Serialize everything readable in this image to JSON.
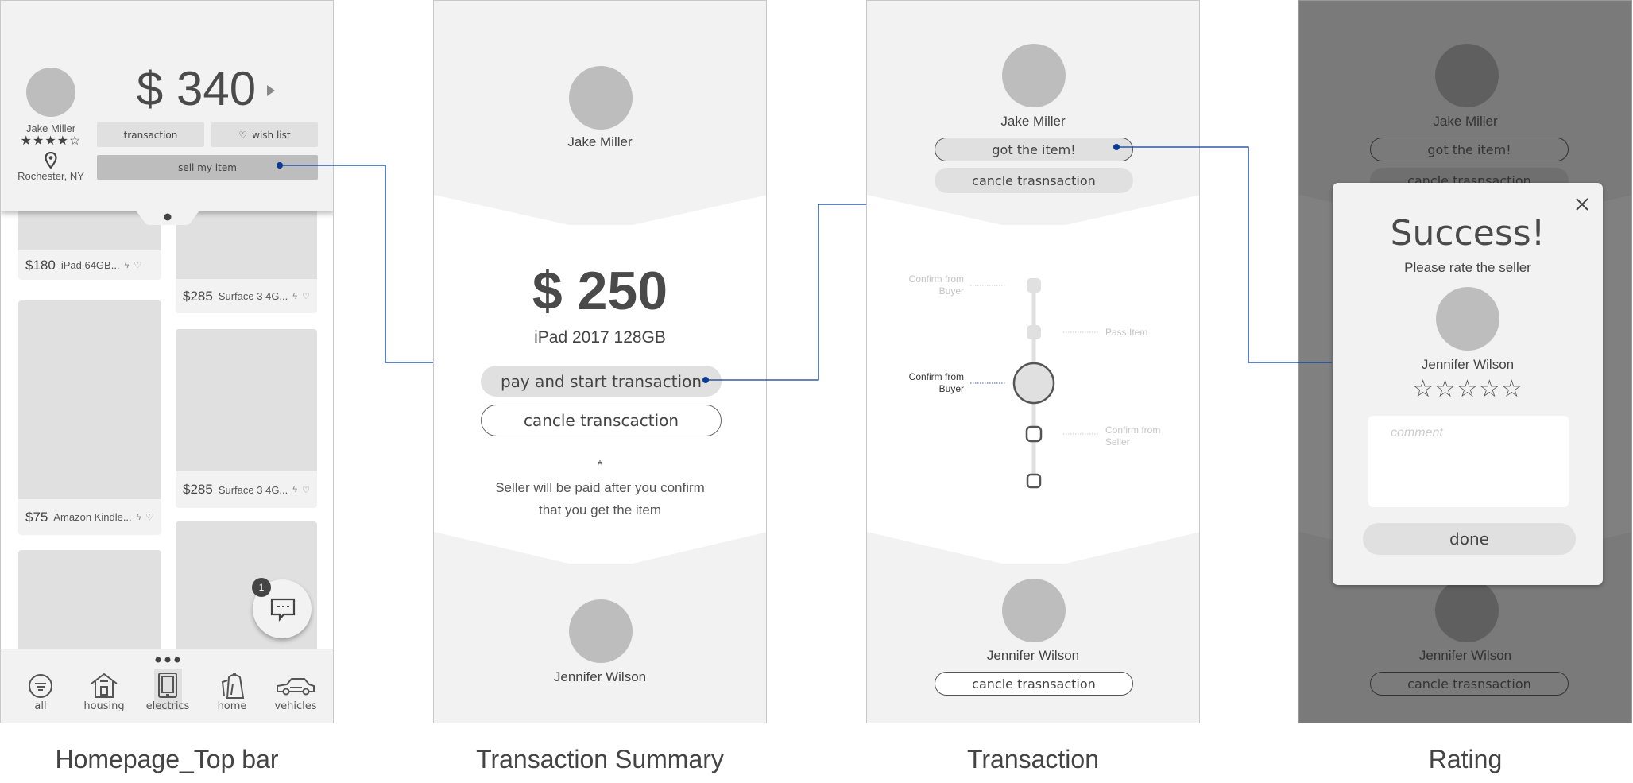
{
  "colors": {
    "connector": "#0b3a94",
    "panel_bg": "#f2f2f2",
    "overlay": "#7b7b7b"
  },
  "homepage": {
    "caption": "Homepage_Top bar",
    "user": {
      "name": "Jake Miller",
      "rating": 4,
      "rating_max": 5,
      "stars": "★★★★☆",
      "location": "Rochester, NY"
    },
    "balance": "$ 340",
    "buttons": {
      "transaction": "transaction",
      "wish_list": "wish list",
      "sell": "sell my item"
    },
    "products": [
      {
        "price": "$180",
        "title": "iPad 64GB..."
      },
      {
        "price": "$285",
        "title": "Surface 3 4G..."
      },
      {
        "price": "$75",
        "title": "Amazon Kindle..."
      },
      {
        "price": "$285",
        "title": "Surface 3 4G..."
      }
    ],
    "chat_badge": "1",
    "nav": [
      {
        "label": "all",
        "icon": "filter-icon"
      },
      {
        "label": "housing",
        "icon": "house-icon"
      },
      {
        "label": "electrics",
        "icon": "tablet-icon",
        "active": true
      },
      {
        "label": "home",
        "icon": "kettle-icon"
      },
      {
        "label": "vehicles",
        "icon": "car-icon"
      }
    ]
  },
  "summary": {
    "caption": "Transaction Summary",
    "seller": "Jake Miller",
    "price": "$ 250",
    "item": "iPad 2017 128GB",
    "pay": "pay and start transaction",
    "cancel": "cancle transcaction",
    "note_mark": "*",
    "note_line1": "Seller will be paid after you confirm",
    "note_line2": "that you get the item",
    "buyer": "Jennifer Wilson"
  },
  "transaction": {
    "caption": "Transaction",
    "seller": "Jake Miller",
    "got_item": "got the item!",
    "cancel_top": "cancle trasnsaction",
    "steps": [
      {
        "label": "Confirm from Buyer",
        "state": "done"
      },
      {
        "label": "Pass Item",
        "state": "done"
      },
      {
        "label": "Confirm from Buyer",
        "state": "current"
      },
      {
        "label": "Confirm from Seller",
        "state": "pending"
      },
      {
        "label": "",
        "state": "pending"
      }
    ],
    "buyer": "Jennifer Wilson",
    "cancel_bottom": "cancle trasnsaction"
  },
  "rating": {
    "caption": "Rating",
    "seller": "Jake Miller",
    "got_item": "got the item!",
    "cancel_top": "cancle trasnsaction",
    "buyer": "Jennifer Wilson",
    "cancel_bottom": "cancle trasnsaction",
    "modal": {
      "title": "Success!",
      "subtitle": "Please rate the seller",
      "name": "Jennifer Wilson",
      "rating": 0,
      "rating_max": 5,
      "stars": "☆☆☆☆☆",
      "comment_placeholder": "comment",
      "done": "done"
    }
  }
}
